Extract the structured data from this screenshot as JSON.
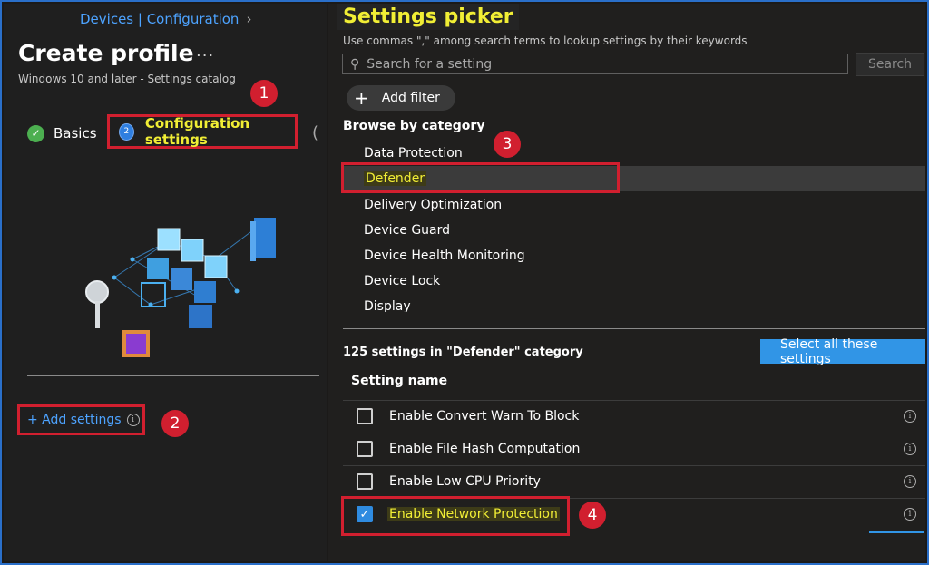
{
  "breadcrumb": {
    "text": "Devices | Configuration"
  },
  "create_profile": {
    "title": "Create profile",
    "more": "...",
    "subtitle": "Windows 10 and later - Settings catalog",
    "steps": [
      {
        "label": "Basics",
        "status": "complete"
      },
      {
        "label": "Configuration settings",
        "number": "2",
        "status": "current"
      }
    ],
    "add_settings_label": "+ Add settings"
  },
  "annotations": [
    "1",
    "2",
    "3",
    "4"
  ],
  "settings_picker": {
    "title": "Settings picker",
    "hint": "Use commas \",\" among search terms to lookup settings by their keywords",
    "search_placeholder": "Search for a setting",
    "search_button": "Search",
    "add_filter": "Add filter",
    "browse_title": "Browse by category",
    "categories": [
      "Data Protection",
      "Defender",
      "Delivery Optimization",
      "Device Guard",
      "Device Health Monitoring",
      "Device Lock",
      "Display"
    ],
    "selected_category": "Defender",
    "count_label": "125 settings in \"Defender\" category",
    "select_all": "Select all these settings",
    "column_header": "Setting name",
    "settings": [
      {
        "name": "Enable Convert Warn To Block",
        "checked": false
      },
      {
        "name": "Enable File Hash Computation",
        "checked": false
      },
      {
        "name": "Enable Low CPU Priority",
        "checked": false
      },
      {
        "name": "Enable Network Protection",
        "checked": true
      }
    ]
  },
  "colors": {
    "highlight_text": "#f1ee35",
    "annotation_red": "#d11f2f",
    "accent_blue": "#3195e6",
    "background": "#1b1a19"
  },
  "icons": [
    "check-icon",
    "ellipsis-icon",
    "search-icon",
    "plus-icon",
    "info-icon",
    "checkbox-icon"
  ]
}
